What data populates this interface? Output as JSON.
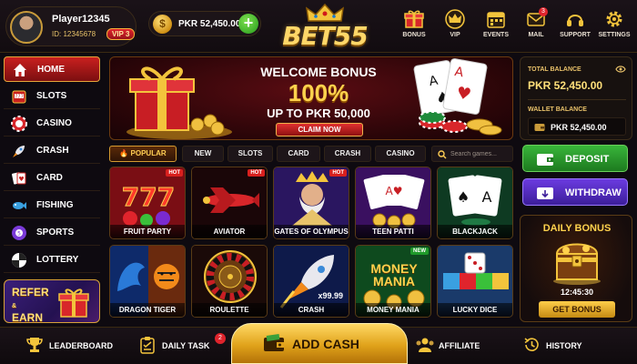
{
  "header": {
    "username": "Player12345",
    "user_id": "ID: 12345678",
    "vip_level": "VIP 3",
    "balance": "PKR 52,450.00",
    "logo_text": "BET55",
    "icons": [
      {
        "label": "BONUS",
        "icon": "gift-icon"
      },
      {
        "label": "VIP",
        "icon": "crown-icon"
      },
      {
        "label": "EVENTS",
        "icon": "calendar-icon"
      },
      {
        "label": "MAIL",
        "icon": "mail-icon",
        "badge": "3"
      },
      {
        "label": "SUPPORT",
        "icon": "headset-icon"
      },
      {
        "label": "SETTINGS",
        "icon": "gear-icon"
      }
    ]
  },
  "sidebar": {
    "items": [
      {
        "label": "HOME",
        "icon": "home-icon",
        "active": true
      },
      {
        "label": "SLOTS",
        "icon": "slot-machine-icon"
      },
      {
        "label": "CASINO",
        "icon": "casino-chip-icon"
      },
      {
        "label": "CRASH",
        "icon": "rocket-icon"
      },
      {
        "label": "CARD",
        "icon": "cards-icon"
      },
      {
        "label": "FISHING",
        "icon": "fish-icon"
      },
      {
        "label": "SPORTS",
        "icon": "sports-ball-icon"
      },
      {
        "label": "LOTTERY",
        "icon": "lottery-ball-icon"
      }
    ],
    "refer_line1": "REFER",
    "refer_amp": "&",
    "refer_line2": "EARN"
  },
  "banner": {
    "title": "WELCOME BONUS",
    "percent": "100%",
    "subtitle": "UP TO PKR 50,000",
    "button": "CLAIM NOW"
  },
  "tabs": {
    "items": [
      "POPULAR",
      "NEW",
      "SLOTS",
      "CARD",
      "CRASH",
      "CASINO"
    ],
    "active": "POPULAR",
    "search_placeholder": "Search games..."
  },
  "games": [
    {
      "name": "FRUIT PARTY",
      "badge": "HOT"
    },
    {
      "name": "AVIATOR",
      "badge": "HOT"
    },
    {
      "name": "GATES OF OLYMPUS",
      "badge": "HOT"
    },
    {
      "name": "TEEN PATTI",
      "badge": ""
    },
    {
      "name": "BLACKJACK",
      "badge": ""
    },
    {
      "name": "DRAGON TIGER",
      "badge": ""
    },
    {
      "name": "ROULETTE",
      "badge": ""
    },
    {
      "name": "CRASH",
      "badge": "",
      "multiplier": "x99.99"
    },
    {
      "name": "MONEY MANIA",
      "badge": "NEW",
      "art_text": "MONEY MANIA"
    },
    {
      "name": "LUCKY DICE",
      "badge": ""
    }
  ],
  "wallet": {
    "total_label": "TOTAL BALANCE",
    "total_value": "PKR 52,450.00",
    "wallet_label": "WALLET BALANCE",
    "wallet_value": "PKR 52,450.00"
  },
  "actions": {
    "deposit": "DEPOSIT",
    "withdraw": "WITHDRAW"
  },
  "daily_bonus": {
    "title": "DAILY BONUS",
    "timer": "12:45:30",
    "button": "GET BONUS"
  },
  "bottom_bar": {
    "leaderboard": "LEADERBOARD",
    "daily_task": "DAILY TASK",
    "daily_task_badge": "2",
    "add_cash": "ADD CASH",
    "affiliate": "AFFILIATE",
    "history": "HISTORY"
  },
  "colors": {
    "accent_gold": "#ffd24d",
    "active_red": "#c9201f",
    "deposit_green": "#39b53a",
    "withdraw_purple": "#6b3be0"
  }
}
